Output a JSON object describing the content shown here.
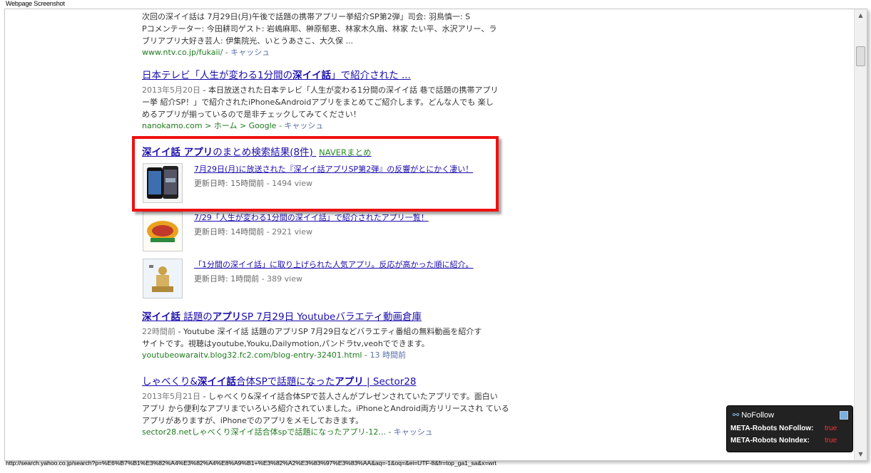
{
  "window_title": "Webpage Screenshot",
  "status_url": "http://search.yahoo.co.jp/search?p=%E6%B7%B1%E3%82%A4%E3%82%A4%E8%A9%B1+%E3%82%A2%E3%83%97%E3%83%AA&aq=-1&oq=&ei=UTF-8&fr=top_ga1_sa&x=wrt",
  "result0": {
    "snippet_line1": "次回の深イイ話は 7月29日(月)午後で話題の携帯アプリー挙紹介SP第2弾」司会: 羽鳥慎一: S",
    "snippet_line2": "Pコメンテーター: 今田耕司ゲスト: 岩嶋麻耶、榊原郁恵、林家木久扇、林家 たい平、水沢アリー、ラ",
    "snippet_line3": "ブリアプリ大好き芸人: 伊集院光、いとうあさこ、大久保 ...",
    "url": "www.ntv.co.jp/fukaii/",
    "cache": "キャッシュ"
  },
  "result1": {
    "title_a": "日本テレビ「人生が変わる1分間の",
    "title_b": "深イイ話",
    "title_c": "」で紹介された ...",
    "date": "2013年5月20日",
    "snippet_line1": "本日放送された日本テレビ「人生が変わる1分間の深イイ話 巷で話題の携帯アプリ",
    "snippet_line2": "ー挙 紹介SP！」で紹介されたiPhone&Androidアプリをまとめてご紹介します。どんな人でも 楽し",
    "snippet_line3": "めるアプリが揃っているので是非チェックしてみてください！",
    "url": "nanokamo.com > ホーム > Google",
    "cache": "キャッシュ"
  },
  "naver": {
    "title_a": "深イイ話 アプリ",
    "title_b": "のまとめ検索結果(8件)",
    "source": "NAVERまとめ",
    "items": [
      {
        "title": "7月29日(月)に放送された『深イイ話アプリSP第2弾』の反響がとにかく凄い！",
        "updated": "更新日時: 15時間前",
        "views": "1494 view"
      },
      {
        "title": "7/29「人生が変わる1分間の深イイ話」で紹介されたアプリ一覧！",
        "updated": "更新日時: 14時間前",
        "views": "2921 view"
      },
      {
        "title": "「1分間の深イイ話」に取り上げられた人気アプリ。反応が高かった順に紹介。",
        "updated": "更新日時: 1時間前",
        "views": "389 view"
      }
    ]
  },
  "result3": {
    "title_a": "深イイ話",
    "title_b": " 話題の",
    "title_c": "アプリ",
    "title_d": "SP 7月29日 Youtubeバラエティ動画倉庫",
    "date": "22時間前",
    "snippet_line1": "Youtube 深イイ話 話題のアプリSP 7月29日などバラエティ番組の無料動画を紹介す",
    "snippet_line2": "サイトです。視聴はyoutube,Youku,Dailymotion,パンドラtv,veohでできます。",
    "url": "youtubeowaraitv.blog32.fc2.com/blog-entry-32401.html",
    "cache": "13 時間前"
  },
  "result4": {
    "title_a": "しゃべくり&",
    "title_b": "深イイ話",
    "title_c": "合体SPで話題になった",
    "title_d": "アプリ",
    "title_e": " | Sector28",
    "date": "2013年5月21日",
    "snippet_line1": "しゃべくり&深イイ話合体SPで芸人さんがプレゼンされていたアプリです。面白い",
    "snippet_line2": "アプリ から便利なアプリまでいろいろ紹介されていました。iPhoneとAndroid両方リリースされ ている",
    "snippet_line3": "アプリがありますが、iPhoneでのアプリをメモしておきます。",
    "url": "sector28.netしゃべくり深イイ話合体spで話題になったアプリ-12...",
    "cache": "キャッシュ"
  },
  "nofollow_panel": {
    "title": "NoFollow",
    "row1_label": "META-Robots NoFollow:",
    "row1_value": "true",
    "row2_label": "META-Robots NoIndex:",
    "row2_value": "true"
  },
  "colors": {
    "link": "#1a0dab",
    "url_green": "#1f7a1f",
    "highlight": "#ee1111"
  }
}
